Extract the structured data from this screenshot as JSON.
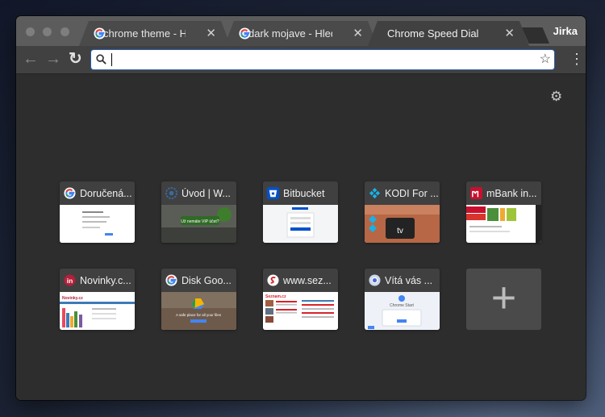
{
  "window": {
    "tabs": [
      {
        "title": "chrome theme - Hledat Googlem",
        "icon": "google-icon",
        "close": "✕"
      },
      {
        "title": "dark mojave - Hledat Googlem",
        "icon": "google-icon",
        "close": "✕"
      },
      {
        "title": "Chrome Speed Dial",
        "icon": "",
        "close": "✕",
        "active": true
      }
    ],
    "profile": "Jirka"
  },
  "toolbar": {
    "back": "←",
    "forward": "→",
    "reload": "↻",
    "search_icon": "search-icon",
    "omnibox_value": "",
    "star": "☆",
    "menu": "⋮"
  },
  "speed_dial": {
    "settings": "⚙",
    "tiles": [
      {
        "label": "Doručená...",
        "icon": "google-icon"
      },
      {
        "label": "Úvod | W...",
        "icon": "wordpress-icon"
      },
      {
        "label": "Bitbucket",
        "icon": "bitbucket-icon"
      },
      {
        "label": "KODI For ...",
        "icon": "kodi-icon"
      },
      {
        "label": "mBank in...",
        "icon": "mbank-icon"
      },
      {
        "label": "Novinky.c...",
        "icon": "novinky-icon"
      },
      {
        "label": "Disk Goo...",
        "icon": "google-icon"
      },
      {
        "label": "www.sez...",
        "icon": "seznam-icon"
      },
      {
        "label": "Vítá vás ...",
        "icon": "chrome-icon"
      }
    ],
    "add": "+",
    "thumb_texts": {
      "wp_button": "Už nemáte VIP účet?",
      "drive_tagline": "A safe place for all your files",
      "kodi_tv": "tv",
      "seznam_title": "Seznam.cz",
      "novinky_title": "Novinky.cz",
      "chrome_title": "Chrome Start"
    }
  },
  "colors": {
    "frame": "#5c5c5c",
    "toolbar": "#414141",
    "content": "#2d2d2d",
    "tile": "#404040",
    "accent": "#2a5db0"
  }
}
